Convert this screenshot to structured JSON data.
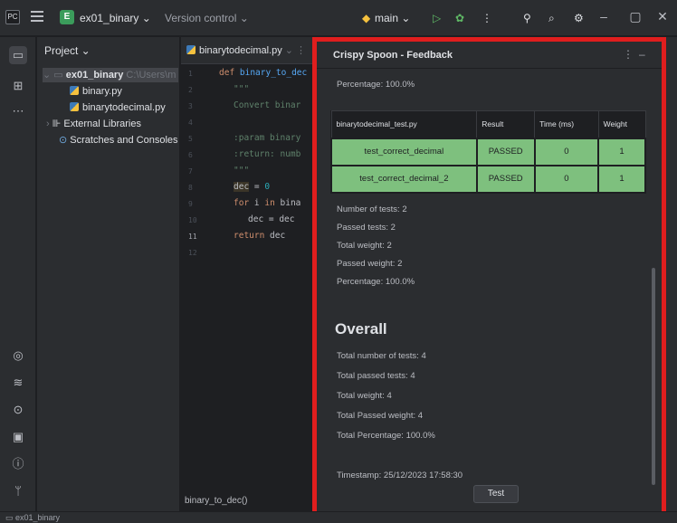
{
  "titlebar": {
    "project_badge": "E",
    "project_name": "ex01_binary ⌄",
    "vcs": "Version control ⌄",
    "branch": "main ⌄"
  },
  "project_panel": {
    "header": "Project ⌄",
    "root": "ex01_binary",
    "root_path": "C:\\Users\\m",
    "files": [
      "binary.py",
      "binarytodecimal.py"
    ],
    "external": "External Libraries",
    "scratches": "Scratches and Consoles"
  },
  "editor": {
    "tab": "binarytodecimal.py",
    "line_numbers": [
      "1",
      "2",
      "3",
      "4",
      "5",
      "6",
      "7",
      "8",
      "9",
      "10",
      "11",
      "12"
    ],
    "footer": "binary_to_dec()"
  },
  "feedback": {
    "title": "Crispy Spoon - Feedback",
    "percentage_top": "Percentage: 100.0%",
    "table": {
      "headers": [
        "binarytodecimal_test.py",
        "Result",
        "Time (ms)",
        "Weight"
      ],
      "rows": [
        [
          "test_correct_decimal",
          "PASSED",
          "0",
          "1"
        ],
        [
          "test_correct_decimal_2",
          "PASSED",
          "0",
          "1"
        ]
      ]
    },
    "stats": [
      "Number of tests: 2",
      "Passed tests: 2",
      "Total weight: 2",
      "Passed weight: 2",
      "Percentage: 100.0%"
    ],
    "overall_title": "Overall",
    "overall": [
      "Total number of tests: 4",
      "Total passed tests: 4",
      "Total weight: 4",
      "Total Passed weight: 4",
      "Total Percentage: 100.0%"
    ],
    "timestamp": "Timestamp: 25/12/2023 17:58:30",
    "test_button": "Test",
    "result_color": "#7ec07e"
  },
  "statusbar": {
    "path": "ex01_binary"
  }
}
